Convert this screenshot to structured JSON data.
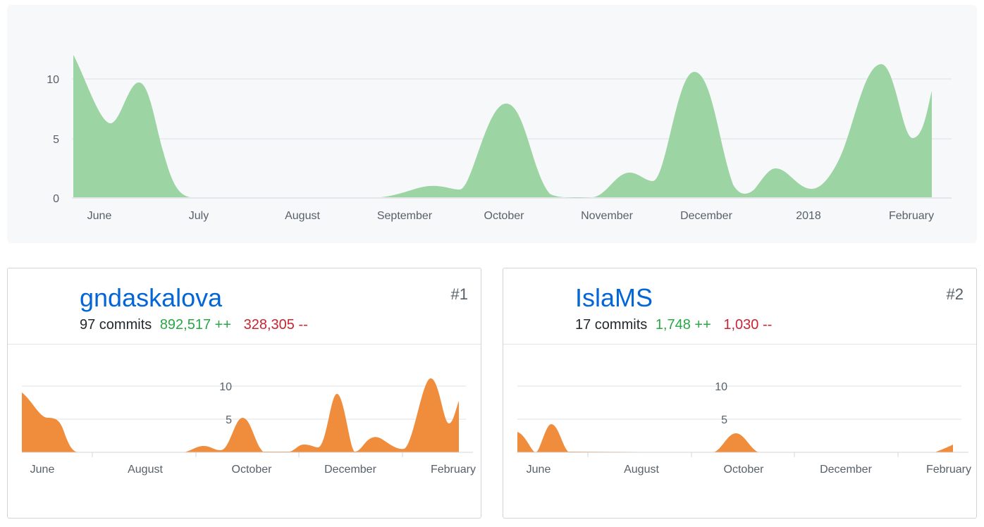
{
  "overview": {
    "y_ticks": [
      "10",
      "5",
      "0"
    ],
    "x_ticks": [
      "June",
      "July",
      "August",
      "September",
      "October",
      "November",
      "December",
      "2018",
      "February"
    ]
  },
  "contributors": [
    {
      "username": "gndaskalova",
      "commits": "97 commits",
      "additions": "892,517 ++",
      "deletions": "328,305 --",
      "rank": "#1",
      "y_ticks": [
        "10",
        "5"
      ],
      "x_ticks": [
        "June",
        "August",
        "October",
        "December",
        "February"
      ]
    },
    {
      "username": "IslaMS",
      "commits": "17 commits",
      "additions": "1,748 ++",
      "deletions": "1,030 --",
      "rank": "#2",
      "y_ticks": [
        "10",
        "5"
      ],
      "x_ticks": [
        "June",
        "August",
        "October",
        "December",
        "February"
      ]
    }
  ],
  "colors": {
    "overview_fill": "#9cd4a3",
    "contributor_fill": "#f08d3c",
    "link": "#0366d6",
    "additions": "#28a745",
    "deletions": "#cb2431"
  },
  "chart_data": [
    {
      "type": "area",
      "x": [
        "Jun 1",
        "Jun 8",
        "Jun 15",
        "Jun 22",
        "Jun 29",
        "Jul 6",
        "Jul 13",
        "Jul 20",
        "Jul 27",
        "Aug 3",
        "Aug 10",
        "Aug 17",
        "Aug 24",
        "Aug 31",
        "Sep 7",
        "Sep 14",
        "Sep 21",
        "Sep 28",
        "Oct 5",
        "Oct 12",
        "Oct 19",
        "Oct 26",
        "Nov 2",
        "Nov 9",
        "Nov 16",
        "Nov 23",
        "Nov 30",
        "Dec 7",
        "Dec 14",
        "Dec 21",
        "Dec 28",
        "Jan 4",
        "Jan 11",
        "Jan 18",
        "Jan 25",
        "Feb 1",
        "Feb 8"
      ],
      "series": [
        {
          "values": [
            12,
            6,
            9.5,
            0,
            0,
            0,
            0,
            0,
            0,
            0,
            0,
            0,
            0,
            0,
            0.5,
            1,
            0.8,
            7.8,
            1,
            0,
            0,
            2,
            1.5,
            10.5,
            0.5,
            2.4,
            1,
            6,
            11,
            5,
            9
          ]
        }
      ],
      "ylim": [
        0,
        12
      ],
      "xlabel": "",
      "ylabel": ""
    },
    {
      "type": "area",
      "series": [
        {
          "name": "gndaskalova",
          "values": [
            9,
            5.5,
            0,
            0,
            0,
            0,
            0,
            1,
            0.3,
            5.2,
            0,
            1.2,
            1,
            8.7,
            0.3,
            2.4,
            1,
            8,
            11,
            5,
            8
          ]
        }
      ],
      "ylim": [
        0,
        12
      ]
    },
    {
      "type": "area",
      "series": [
        {
          "name": "IslaMS",
          "values": [
            3,
            0.3,
            4,
            0,
            0,
            0,
            0,
            0,
            0,
            0,
            3,
            0,
            0,
            0,
            0,
            0,
            0,
            0,
            0,
            0,
            1.2
          ]
        }
      ],
      "ylim": [
        0,
        12
      ]
    }
  ]
}
